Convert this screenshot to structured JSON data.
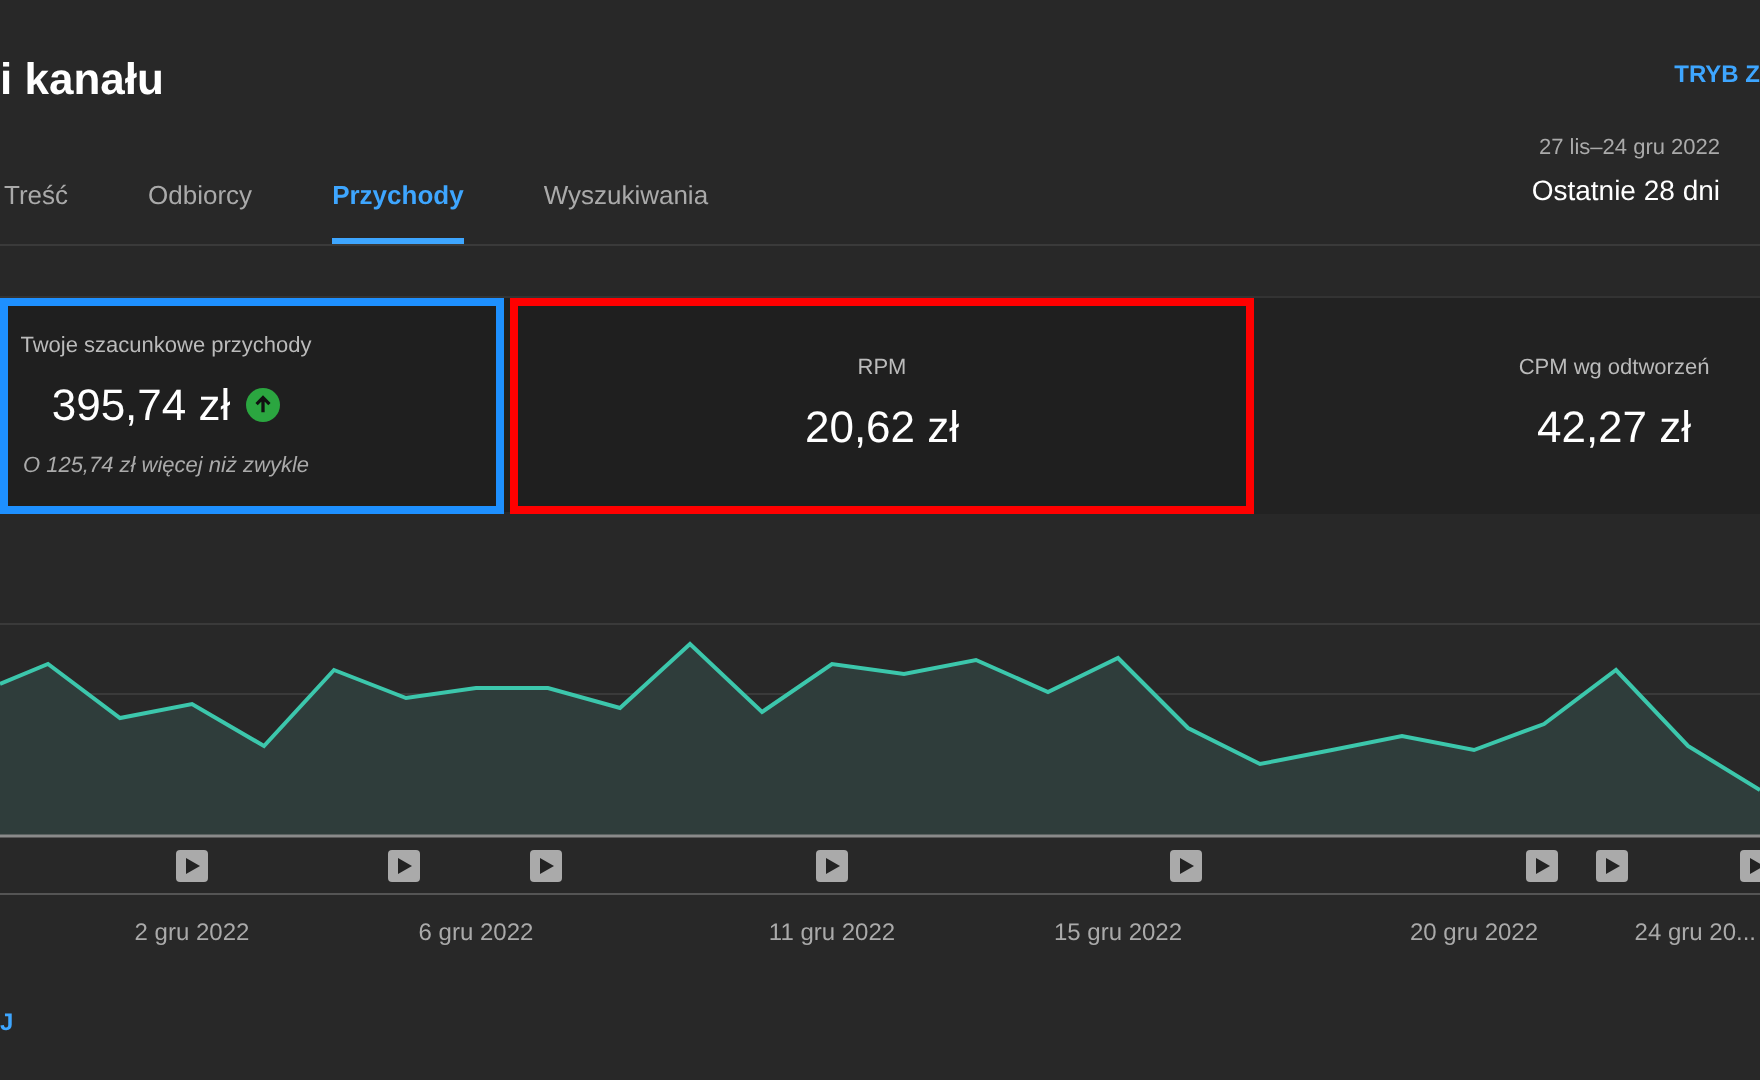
{
  "header": {
    "title": "i kanału",
    "mode_link": "TRYB Z"
  },
  "tabs": [
    {
      "label": "Treść",
      "selected": false
    },
    {
      "label": "Odbiorcy",
      "selected": false
    },
    {
      "label": "Przychody",
      "selected": true
    },
    {
      "label": "Wyszukiwania",
      "selected": false
    }
  ],
  "date_range": {
    "dates": "27 lis–24 gru 2022",
    "label": "Ostatnie 28 dni"
  },
  "metrics": [
    {
      "label": "Twoje szacunkowe przychody",
      "value": "395,74 zł",
      "increased": true,
      "note": "O 125,74 zł więcej niż zwykle",
      "color": "#1e90ff"
    },
    {
      "label": "RPM",
      "value": "20,62 zł",
      "color": "#ff0000"
    },
    {
      "label": "CPM wg odtworzeń",
      "value": "42,27 zł"
    }
  ],
  "chart": {
    "x_labels": [
      "2 gru 2022",
      "6 gru 2022",
      "11 gru 2022",
      "15 gru 2022",
      "20 gru 2022",
      "24 gru 20..."
    ]
  },
  "footer_link": "J"
}
